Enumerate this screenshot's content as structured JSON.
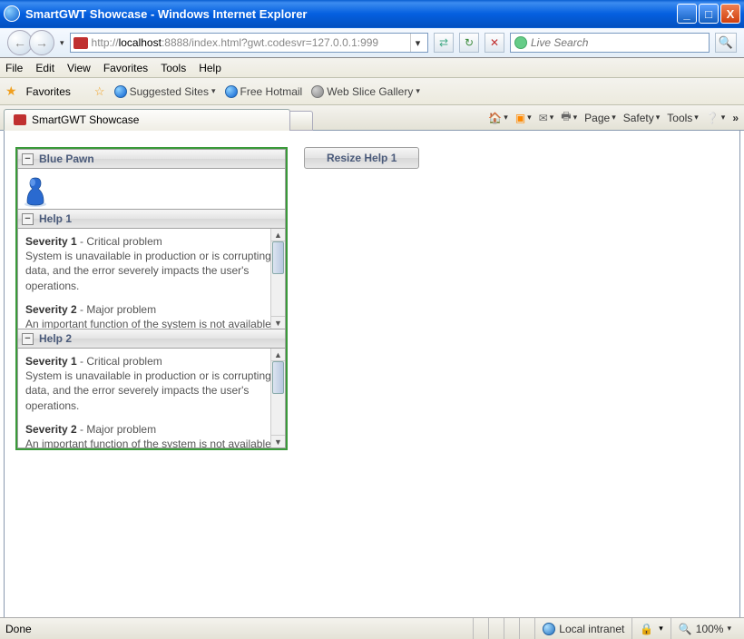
{
  "window": {
    "title": "SmartGWT Showcase - Windows Internet Explorer",
    "min": "_",
    "max": "□",
    "close": "X"
  },
  "nav": {
    "back": "←",
    "fwd": "→",
    "url_prefix": "http://",
    "url_host": "localhost",
    "url_rest": ":8888/index.html?gwt.codesvr=127.0.0.1:999",
    "dropdown": "▾",
    "refresh": "↻",
    "stop": "✕",
    "search_placeholder": "Live Search",
    "search_go": "🔍"
  },
  "menu": {
    "file": "File",
    "edit": "Edit",
    "view": "View",
    "favorites": "Favorites",
    "tools": "Tools",
    "help": "Help"
  },
  "fav": {
    "button": "Favorites",
    "suggested": "Suggested Sites",
    "hotmail": "Free Hotmail",
    "webslice": "Web Slice Gallery",
    "arrow": "▾"
  },
  "tab": {
    "label": "SmartGWT Showcase"
  },
  "tabtools": {
    "page": "Page",
    "safety": "Safety",
    "tools": "Tools",
    "more": "»",
    "arrow": "▾"
  },
  "panel": {
    "section1_title": "Blue Pawn",
    "section2_title": "Help 1",
    "section3_title": "Help 2",
    "collapse": "−",
    "sev1_label": "Severity 1",
    "sev1_rest": " - Critical problem",
    "sev1_body": "System is unavailable in production or is corrupting data, and the error severely impacts the user's operations.",
    "sev2_label": "Severity 2",
    "sev2_rest": " - Major problem",
    "sev2_body": "An important function of the system is not available in production, and the user's"
  },
  "button": {
    "resize": "Resize Help 1"
  },
  "status": {
    "done": "Done",
    "zone": "Local intranet",
    "zoom": "100%"
  }
}
